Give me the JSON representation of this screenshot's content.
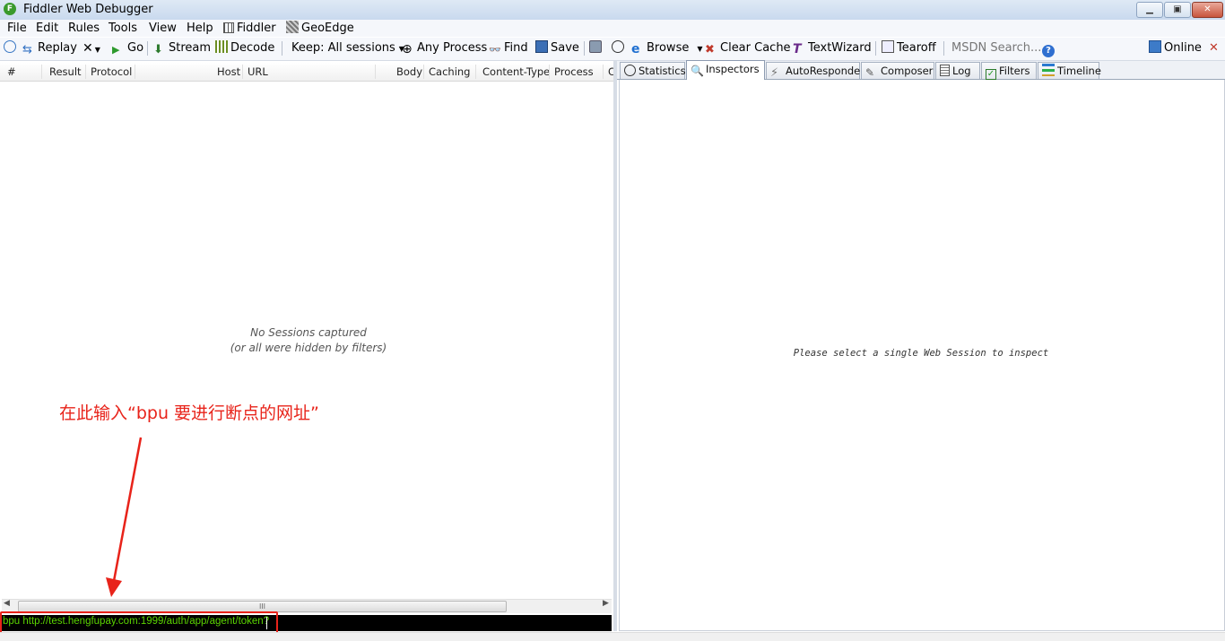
{
  "window": {
    "title": "Fiddler Web Debugger",
    "logo_letter": "F"
  },
  "title_buttons": {
    "minimize": "▁",
    "maximize": "▣",
    "close": "✕"
  },
  "menu": [
    "File",
    "Edit",
    "Rules",
    "Tools",
    "View",
    "Help",
    "Fiddler",
    "GeoEdge"
  ],
  "toolbar": {
    "replay": "Replay",
    "remove": "✕",
    "go": "Go",
    "stream": "Stream",
    "decode": "Decode",
    "keep": "Keep: All sessions",
    "process": "Any Process",
    "find": "Find",
    "save": "Save",
    "browse": "Browse",
    "clear_cache": "Clear Cache",
    "textwizard": "TextWizard",
    "tearoff": "Tearoff",
    "msdn_search": "MSDN Search...",
    "online": "Online",
    "online_close": "✕"
  },
  "sessions": {
    "columns": [
      "#",
      "Result",
      "Protocol",
      "Host",
      "URL",
      "Body",
      "Caching",
      "Content-Type",
      "Process",
      "C"
    ],
    "empty_line1": "No Sessions captured",
    "empty_line2": "(or all were hidden by filters)",
    "scroll_grip": "III",
    "scroll_left": "◀",
    "scroll_right": "▶"
  },
  "quickexec": {
    "value": "bpu http://test.hengfupay.com:1999/auth/app/agent/token?"
  },
  "tabs": [
    {
      "label": "Statistics",
      "icon": "stopwatch-icon"
    },
    {
      "label": "Inspectors",
      "icon": "magnifier-icon",
      "active": true
    },
    {
      "label": "AutoResponder",
      "icon": "lightning-icon"
    },
    {
      "label": "Composer",
      "icon": "pencil-icon"
    },
    {
      "label": "Log",
      "icon": "document-icon"
    },
    {
      "label": "Filters",
      "icon": "checkbox-icon"
    },
    {
      "label": "Timeline",
      "icon": "timeline-icon"
    }
  ],
  "inspector": {
    "message": "Please select a single Web Session to inspect"
  },
  "annotation": {
    "text": "在此输入“bpu 要进行断点的网址”",
    "color": "#e8231a"
  },
  "colors": {
    "accent": "#e8231a",
    "quickexec_text": "#5bd400",
    "quickexec_bg": "#000000"
  }
}
